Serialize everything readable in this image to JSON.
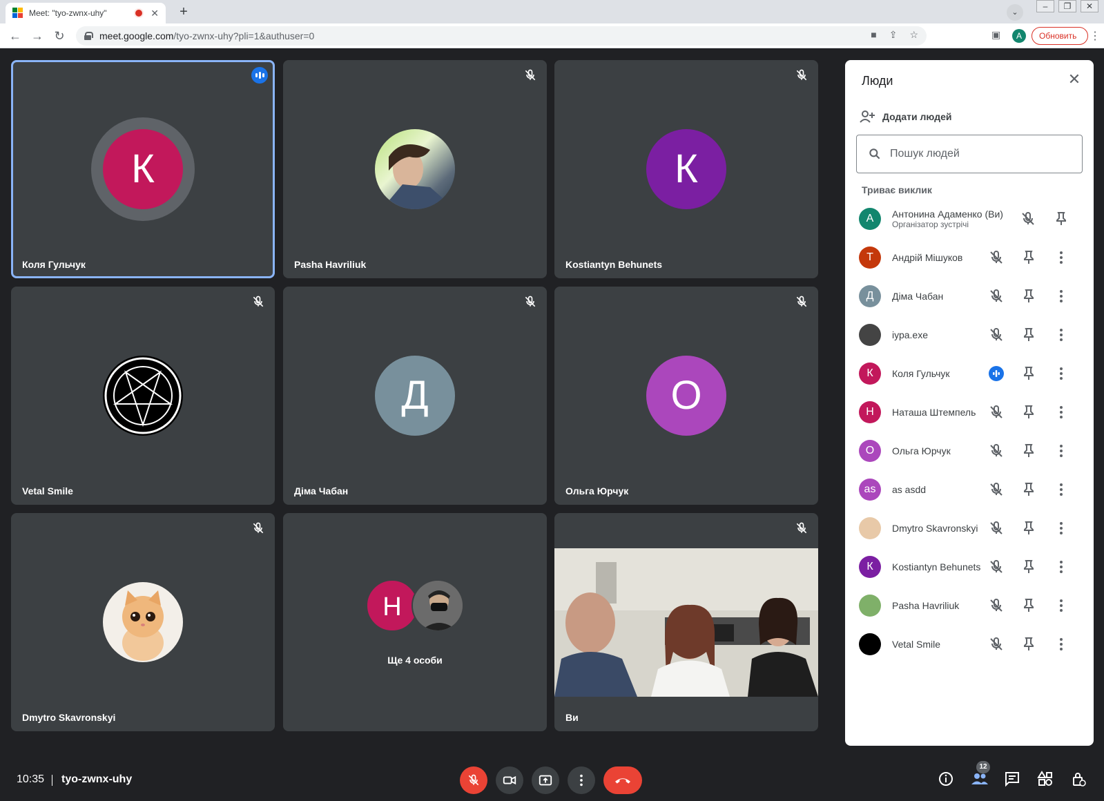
{
  "browser": {
    "tab_title": "Meet: \"tyo-zwnx-uhy\"",
    "url_host": "meet.google.com",
    "url_path": "/tyo-zwnx-uhy?pli=1&authuser=0",
    "profile_initial": "A",
    "update_label": "Обновить",
    "new_tab": "+",
    "tab_close": "✕"
  },
  "tiles": [
    {
      "name": "Коля Гульчук",
      "initial": "К",
      "color": "#c2185b",
      "speaking": true
    },
    {
      "name": "Pasha Havriliuk",
      "initial": "",
      "color": "#7fb069",
      "photo": "photo-avatar"
    },
    {
      "name": "Kostiantyn Behunets",
      "initial": "К",
      "color": "#7b1fa2"
    },
    {
      "name": "Vetal Smile",
      "initial": "",
      "color": "#000000",
      "photo": "pentagram-avatar"
    },
    {
      "name": "Діма Чабан",
      "initial": "Д",
      "color": "#78909c"
    },
    {
      "name": "Ольга Юрчук",
      "initial": "О",
      "color": "#ab47bc"
    },
    {
      "name": "Dmytro Skavronskyi",
      "initial": "",
      "color": "#f4d3b0",
      "photo": "kitten-avatar"
    },
    {
      "name": "",
      "initial": "Н",
      "color": "#c2185b",
      "more_label": "Ще 4 особи"
    },
    {
      "name": "Ви",
      "initial": "",
      "color": "#cfcfc6",
      "photo": "camera-video"
    }
  ],
  "panel": {
    "title": "Люди",
    "add_people": "Додати людей",
    "search_placeholder": "Пошук людей",
    "section": "Триває виклик",
    "people": [
      {
        "name": "Антонина Адаменко (Ви)",
        "sub": "Організатор зустрічі",
        "initial": "А",
        "color": "#12866e"
      },
      {
        "name": "Андрій Мішуков",
        "initial": "Т",
        "color": "#c4380b"
      },
      {
        "name": "Діма Чабан",
        "initial": "Д",
        "color": "#78909c"
      },
      {
        "name": "іура.exe",
        "initial": "",
        "color": "#444444"
      },
      {
        "name": "Коля Гульчук",
        "initial": "К",
        "color": "#c2185b",
        "speaking": true
      },
      {
        "name": "Наташа Штемпель",
        "initial": "Н",
        "color": "#c2185b"
      },
      {
        "name": "Ольга Юрчук",
        "initial": "О",
        "color": "#ab47bc"
      },
      {
        "name": "as asdd",
        "initial": "as",
        "color": "#ab47bc"
      },
      {
        "name": "Dmytro Skavronskyi",
        "initial": "",
        "color": "#e8c9a8"
      },
      {
        "name": "Kostiantyn Behunets",
        "initial": "К",
        "color": "#7b1fa2"
      },
      {
        "name": "Pasha Havriliuk",
        "initial": "",
        "color": "#7fb069"
      },
      {
        "name": "Vetal Smile",
        "initial": "",
        "color": "#000000"
      }
    ]
  },
  "bottom": {
    "time": "10:35",
    "meeting_code": "tyo-zwnx-uhy",
    "people_count": "12"
  },
  "colors": {
    "background": "#202124",
    "tile": "#3c4043",
    "accent": "#1a73e8",
    "danger": "#ea4335"
  }
}
